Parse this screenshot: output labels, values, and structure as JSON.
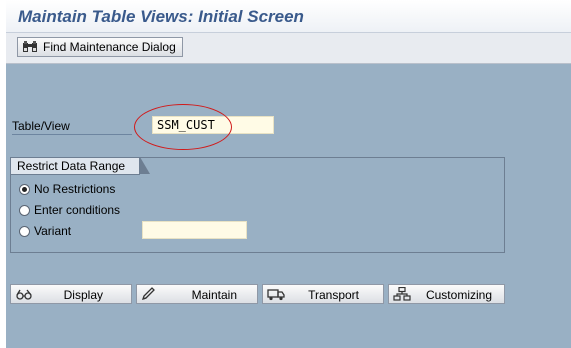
{
  "title": "Maintain Table Views: Initial Screen",
  "toolbar": {
    "find_label": "Find Maintenance Dialog"
  },
  "form": {
    "table_view_label": "Table/View",
    "table_view_value": "SSM_CUST"
  },
  "restrict": {
    "title": "Restrict Data Range",
    "options": [
      {
        "label": "No Restrictions",
        "checked": true
      },
      {
        "label": "Enter conditions",
        "checked": false
      },
      {
        "label": "Variant",
        "checked": false
      }
    ],
    "variant_value": ""
  },
  "buttons": {
    "display": "Display",
    "maintain": "Maintain",
    "transport": "Transport",
    "customizing": "Customizing"
  },
  "colors": {
    "background": "#99b0c4",
    "title": "#3a5a8c",
    "highlight": "#d11a1a",
    "input_bg": "#fffbe6"
  }
}
